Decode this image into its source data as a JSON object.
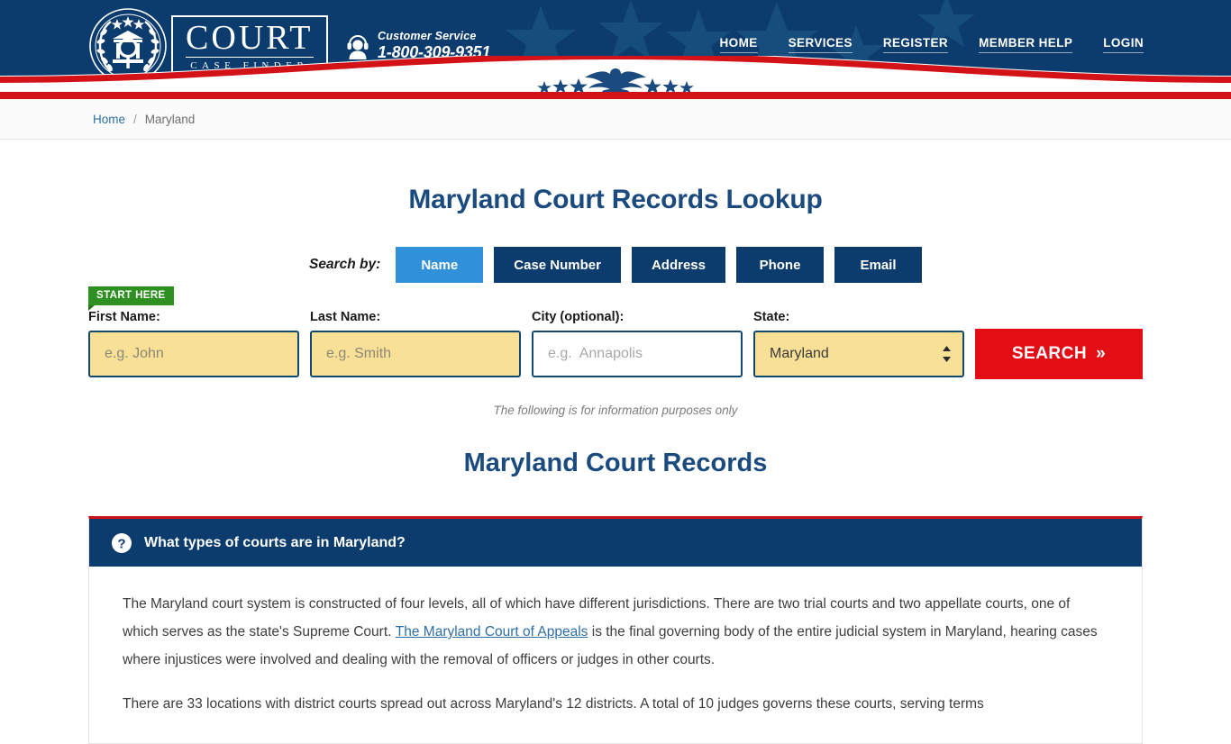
{
  "brand": {
    "name_main": "COURT",
    "name_sub": "CASE FINDER",
    "logo_icon": "court-emblem-icon"
  },
  "customer_service": {
    "label": "Customer Service",
    "phone": "1-800-309-9351",
    "icon": "headset-support-icon"
  },
  "nav": {
    "items": [
      {
        "label": "HOME"
      },
      {
        "label": "SERVICES"
      },
      {
        "label": "REGISTER"
      },
      {
        "label": "MEMBER HELP"
      },
      {
        "label": "LOGIN"
      }
    ]
  },
  "breadcrumb": {
    "home": "Home",
    "separator": "/",
    "current": "Maryland"
  },
  "page": {
    "title": "Maryland Court Records Lookup",
    "section_title": "Maryland Court Records",
    "disclaimer": "The following is for information purposes only"
  },
  "search": {
    "search_by_label": "Search by:",
    "tabs": [
      {
        "label": "Name",
        "active": true
      },
      {
        "label": "Case Number",
        "active": false
      },
      {
        "label": "Address",
        "active": false
      },
      {
        "label": "Phone",
        "active": false
      },
      {
        "label": "Email",
        "active": false
      }
    ],
    "start_here_badge": "START HERE",
    "fields": {
      "first_name": {
        "label": "First Name:",
        "placeholder": "e.g. John",
        "value": ""
      },
      "last_name": {
        "label": "Last Name:",
        "placeholder": "e.g. Smith",
        "value": ""
      },
      "city": {
        "label": "City (optional):",
        "placeholder": "e.g.  Annapolis",
        "value": ""
      },
      "state": {
        "label": "State:",
        "value": "Maryland"
      }
    },
    "submit_label": "SEARCH",
    "submit_chevron": "»"
  },
  "faq": {
    "icon": "question-mark-circle-icon",
    "question": "What types of courts are in Maryland?",
    "paragraph_1_a": "The Maryland court system is constructed of four levels, all of which have different jurisdictions. There are two trial courts and two appellate courts, one of which serves as the state's Supreme Court. ",
    "paragraph_1_link": "The Maryland Court of Appeals",
    "paragraph_1_b": " is the final governing body of the entire judicial system in Maryland, hearing cases where injustices were involved and dealing with the removal of officers or judges in other courts.",
    "paragraph_2": "There are 33 locations with district courts spread out across Maryland's 12 districts. A total of 10 judges governs these courts, serving terms"
  },
  "colors": {
    "navy": "#0c3c6e",
    "red": "#d31217",
    "accent_blue": "#3190da",
    "link_blue": "#2f6ea5",
    "input_yellow": "#f8e196",
    "badge_green": "#2e9020",
    "search_red": "#e30d14"
  }
}
